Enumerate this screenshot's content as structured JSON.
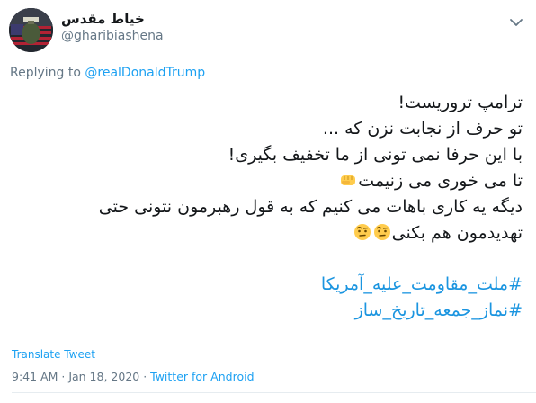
{
  "tweet": {
    "author": {
      "display_name": "خیاط مقدس",
      "handle": "@gharibiashena",
      "avatar_icon": "avatar-image"
    },
    "reply": {
      "prefix": "Replying to ",
      "to": "@realDonaldTrump"
    },
    "text_lines": [
      "ترامپ تروریست!",
      "تو حرف از نجابت نزن که ...",
      "با این حرفا نمی تونی از ما تخفیف بگیری!",
      "تا می خوری می زنیمت",
      "دیگه یه کاری باهات می کنیم که به قول رهبرمون نتونی حتی",
      "تهدیدمون هم بکنی"
    ],
    "emoji": {
      "line4": "oncoming-fist-emoji",
      "line6": "face-with-raised-eyebrow-emoji"
    },
    "hashtags": [
      "#ملت_مقاومت_علیه_آمریکا",
      "#نماز_جمعه_تاریخ_ساز"
    ],
    "translate_label": "Translate Tweet",
    "time": "9:41 AM",
    "separator": " · ",
    "date": "Jan 18, 2020",
    "source": "Twitter for Android"
  },
  "colors": {
    "link": "#1da1f2",
    "muted": "#657786",
    "text": "#14171a",
    "emoji_yellow": "#ffcc4d"
  },
  "icons": {
    "caret": "chevron-down-icon"
  }
}
